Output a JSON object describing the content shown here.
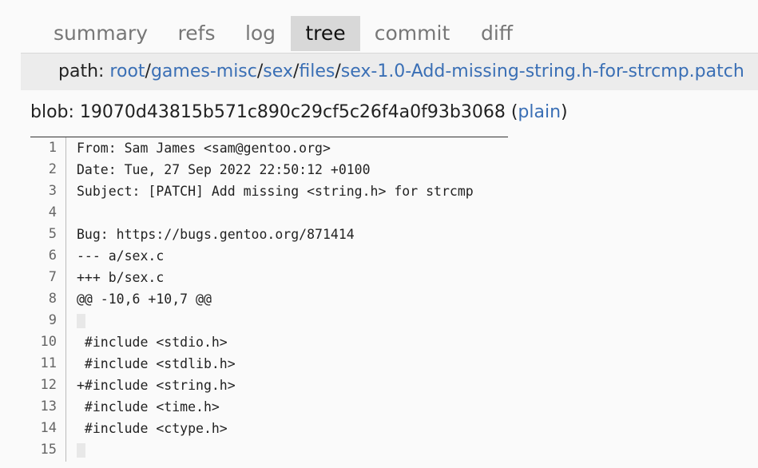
{
  "tabs": [
    {
      "label": "summary",
      "active": false
    },
    {
      "label": "refs",
      "active": false
    },
    {
      "label": "log",
      "active": false
    },
    {
      "label": "tree",
      "active": true
    },
    {
      "label": "commit",
      "active": false
    },
    {
      "label": "diff",
      "active": false
    }
  ],
  "path": {
    "prefix": "path: ",
    "segments": [
      "root",
      "games-misc",
      "sex",
      "files",
      "sex-1.0-Add-missing-string.h-for-strcmp.patch"
    ],
    "separator": "/"
  },
  "blob": {
    "label": "blob: ",
    "hash": "19070d43815b571c890c29cf5c26f4a0f93b3068",
    "open_paren": " (",
    "plain_link": "plain",
    "close_paren": ")"
  },
  "code_lines": [
    {
      "num": "1",
      "text": "From: Sam James <sam@gentoo.org>"
    },
    {
      "num": "2",
      "text": "Date: Tue, 27 Sep 2022 22:50:12 +0100"
    },
    {
      "num": "3",
      "text": "Subject: [PATCH] Add missing <string.h> for strcmp"
    },
    {
      "num": "4",
      "text": ""
    },
    {
      "num": "5",
      "text": "Bug: https://bugs.gentoo.org/871414"
    },
    {
      "num": "6",
      "text": "--- a/sex.c"
    },
    {
      "num": "7",
      "text": "+++ b/sex.c"
    },
    {
      "num": "8",
      "text": "@@ -10,6 +10,7 @@"
    },
    {
      "num": "9",
      "text": " "
    },
    {
      "num": "10",
      "text": " #include <stdio.h>"
    },
    {
      "num": "11",
      "text": " #include <stdlib.h>"
    },
    {
      "num": "12",
      "text": "+#include <string.h>"
    },
    {
      "num": "13",
      "text": " #include <time.h>"
    },
    {
      "num": "14",
      "text": " #include <ctype.h>"
    },
    {
      "num": "15",
      "text": " "
    }
  ]
}
